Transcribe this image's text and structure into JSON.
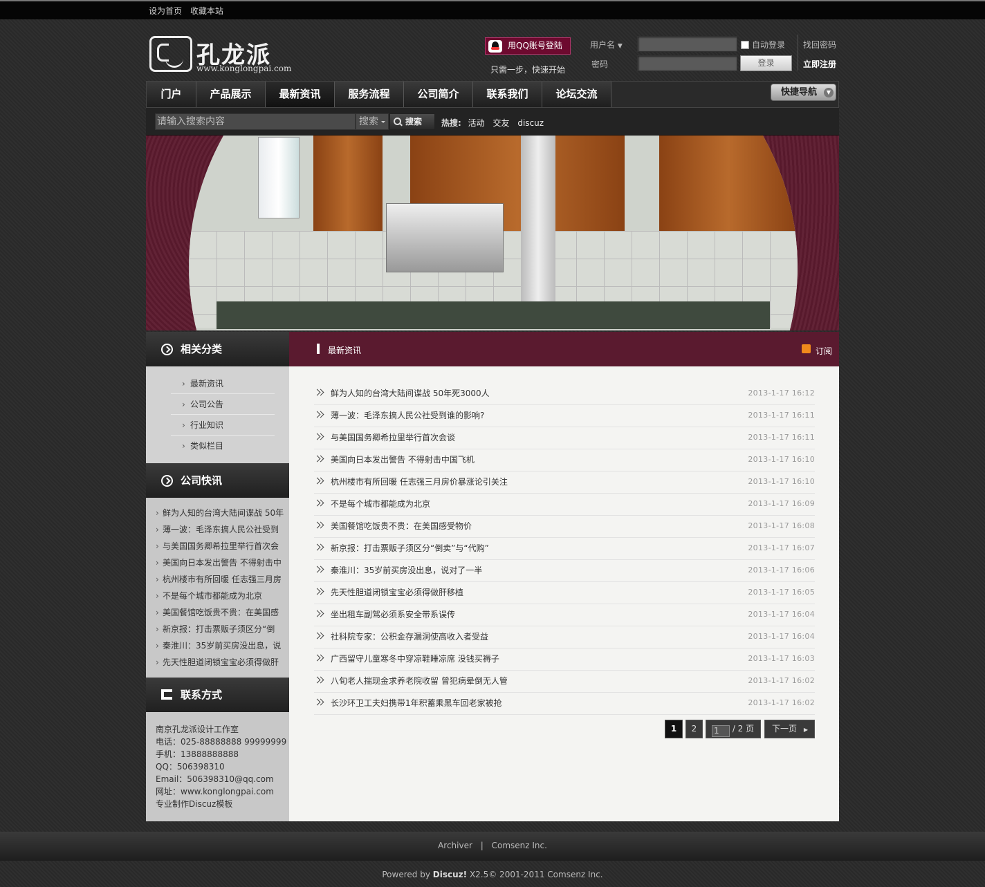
{
  "topbar": {
    "set_home": "设为首页",
    "favorite": "收藏本站"
  },
  "logo": {
    "name": "孔龙派",
    "url": "www.konglongpai.com"
  },
  "qq": {
    "button": "用QQ账号登陆",
    "tip": "只需一步，快速开始"
  },
  "login": {
    "username_label": "用户名",
    "password_label": "密码",
    "auto_login": "自动登录",
    "submit": "登录",
    "find_password": "找回密码",
    "register": "立即注册"
  },
  "nav": {
    "items": [
      "门户",
      "产品展示",
      "最新资讯",
      "服务流程",
      "公司简介",
      "联系我们",
      "论坛交流"
    ],
    "active": "最新资讯",
    "quick_nav": "快捷导航"
  },
  "search": {
    "placeholder": "请输入搜索内容",
    "scope": "搜索",
    "button": "搜索",
    "hot_label": "热搜:",
    "hot": [
      "活动",
      "交友",
      "discuz"
    ]
  },
  "sidebar": {
    "category_title": "相关分类",
    "categories": [
      "最新资讯",
      "公司公告",
      "行业知识",
      "类似栏目"
    ],
    "news_title": "公司快讯",
    "news": [
      "鲜为人知的台湾大陆间谍战 50年",
      "薄一波：毛泽东搞人民公社受到",
      "与美国国务卿希拉里举行首次会",
      "美国向日本发出警告 不得射击中",
      "杭州楼市有所回暖 任志强三月房",
      "不是每个城市都能成为北京",
      "美国餐馆吃饭贵不贵：在美国感",
      "新京报：打击票贩子须区分“倒",
      "秦淮川：35岁前买房没出息，说",
      "先天性胆道闭锁宝宝必须得做肝"
    ],
    "contact_title": "联系方式",
    "contact": [
      "南京孔龙派设计工作室",
      "电话：025-88888888 99999999",
      "手机：13888888888",
      "QQ：506398310",
      "Email：506398310@qq.com",
      "网址：www.konglongpai.com",
      "专业制作Discuz模板"
    ]
  },
  "main": {
    "title": "最新资讯",
    "subscribe": "订阅",
    "articles": [
      {
        "title": "鲜为人知的台湾大陆间谍战 50年死3000人",
        "date": "2013-1-17 16:12"
      },
      {
        "title": "薄一波：毛泽东搞人民公社受到谁的影响?",
        "date": "2013-1-17 16:11"
      },
      {
        "title": "与美国国务卿希拉里举行首次会谈",
        "date": "2013-1-17 16:11"
      },
      {
        "title": "美国向日本发出警告 不得射击中国飞机",
        "date": "2013-1-17 16:10"
      },
      {
        "title": "杭州楼市有所回暖 任志强三月房价暴涨论引关注",
        "date": "2013-1-17 16:10"
      },
      {
        "title": "不是每个城市都能成为北京",
        "date": "2013-1-17 16:09"
      },
      {
        "title": "美国餐馆吃饭贵不贵：在美国感受物价",
        "date": "2013-1-17 16:08"
      },
      {
        "title": "新京报：打击票贩子须区分“倒卖”与“代购”",
        "date": "2013-1-17 16:07"
      },
      {
        "title": "秦淮川：35岁前买房没出息，说对了一半",
        "date": "2013-1-17 16:06"
      },
      {
        "title": "先天性胆道闭锁宝宝必须得做肝移植",
        "date": "2013-1-17 16:05"
      },
      {
        "title": "坐出租车副驾必须系安全带系误传",
        "date": "2013-1-17 16:04"
      },
      {
        "title": "社科院专家：公积金存漏洞使高收入者受益",
        "date": "2013-1-17 16:04"
      },
      {
        "title": "广西留守儿童寒冬中穿凉鞋睡凉席 没钱买褥子",
        "date": "2013-1-17 16:03"
      },
      {
        "title": "八旬老人揣现金求养老院收留 曾犯病晕倒无人管",
        "date": "2013-1-17 16:02"
      },
      {
        "title": "长沙环卫工夫妇携带1年积蓄乘黑车回老家被抢",
        "date": "2013-1-17 16:02"
      }
    ],
    "pager": {
      "current": "1",
      "page2": "2",
      "input_value": "1",
      "total": "/ 2 页",
      "next": "下一页"
    }
  },
  "footer": {
    "archiver": "Archiver",
    "sep": "|",
    "company": "Comsenz Inc.",
    "powered_prefix": "Powered by",
    "brand": "Discuz!",
    "powered_suffix": "X2.5© 2001-2011 Comsenz Inc."
  }
}
